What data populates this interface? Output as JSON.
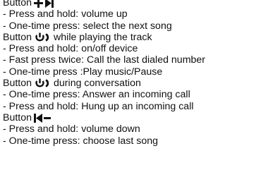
{
  "doc": {
    "lines": [
      "Button",
      "- Press and hold: volume up",
      "- One-time press: select the next song",
      "Button",
      "while playing the track",
      "- Press and hold: on/off device",
      "- Fast press twice: Call the last dialed number",
      "- One-time press :Play music/Pause",
      "Button",
      "during conversation",
      "- One-time press: Answer an incoming call",
      "- Press and hold: Hung up an incoming call",
      "Button",
      "- Press and hold: volume down",
      "- One-time press: choose last song"
    ],
    "icons": {
      "plus_next": "plus-next-track-icon",
      "power": "power-icon",
      "prev_minus": "previous-track-minus-icon"
    }
  }
}
